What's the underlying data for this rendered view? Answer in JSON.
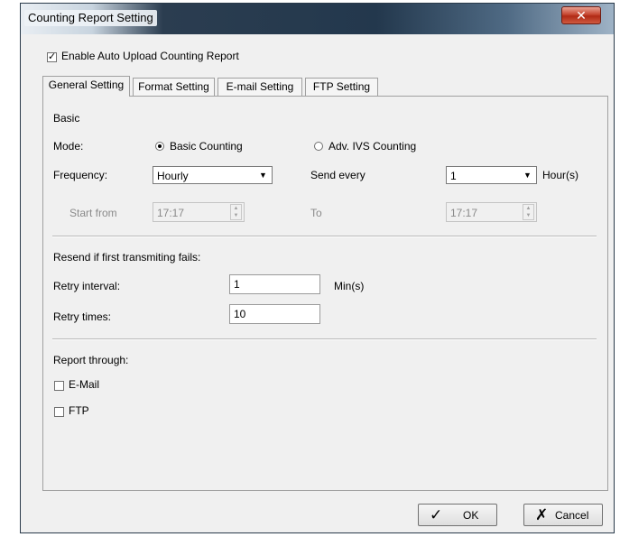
{
  "window": {
    "title": "Counting Report Setting",
    "close_glyph": "✕"
  },
  "enable_upload": {
    "label": "Enable Auto Upload Counting Report",
    "checked": true
  },
  "tabs": [
    {
      "label": "General Setting",
      "active": true
    },
    {
      "label": "Format Setting",
      "active": false
    },
    {
      "label": "E-mail Setting",
      "active": false
    },
    {
      "label": "FTP Setting",
      "active": false
    }
  ],
  "basic": {
    "section_label": "Basic",
    "mode_label": "Mode:",
    "mode_options": [
      {
        "label": "Basic Counting",
        "selected": true
      },
      {
        "label": "Adv. IVS Counting",
        "selected": false
      }
    ],
    "frequency_label": "Frequency:",
    "frequency_value": "Hourly",
    "send_every_label": "Send every",
    "send_every_value": "1",
    "send_every_unit": "Hour(s)",
    "start_from_label": "Start from",
    "start_from_value": "17:17",
    "to_label": "To",
    "to_value": "17:17"
  },
  "resend": {
    "section_label": "Resend if first transmiting fails:",
    "retry_interval_label": "Retry interval:",
    "retry_interval_value": "1",
    "retry_interval_unit": "Min(s)",
    "retry_times_label": "Retry times:",
    "retry_times_value": "10"
  },
  "report_through": {
    "section_label": "Report through:",
    "email_label": "E-Mail",
    "email_checked": false,
    "ftp_label": "FTP",
    "ftp_checked": false
  },
  "buttons": {
    "ok": "OK",
    "cancel": "Cancel"
  },
  "icons": {
    "check": "check-icon",
    "close": "close-x-icon",
    "dropdown": "chevron-down-icon"
  }
}
